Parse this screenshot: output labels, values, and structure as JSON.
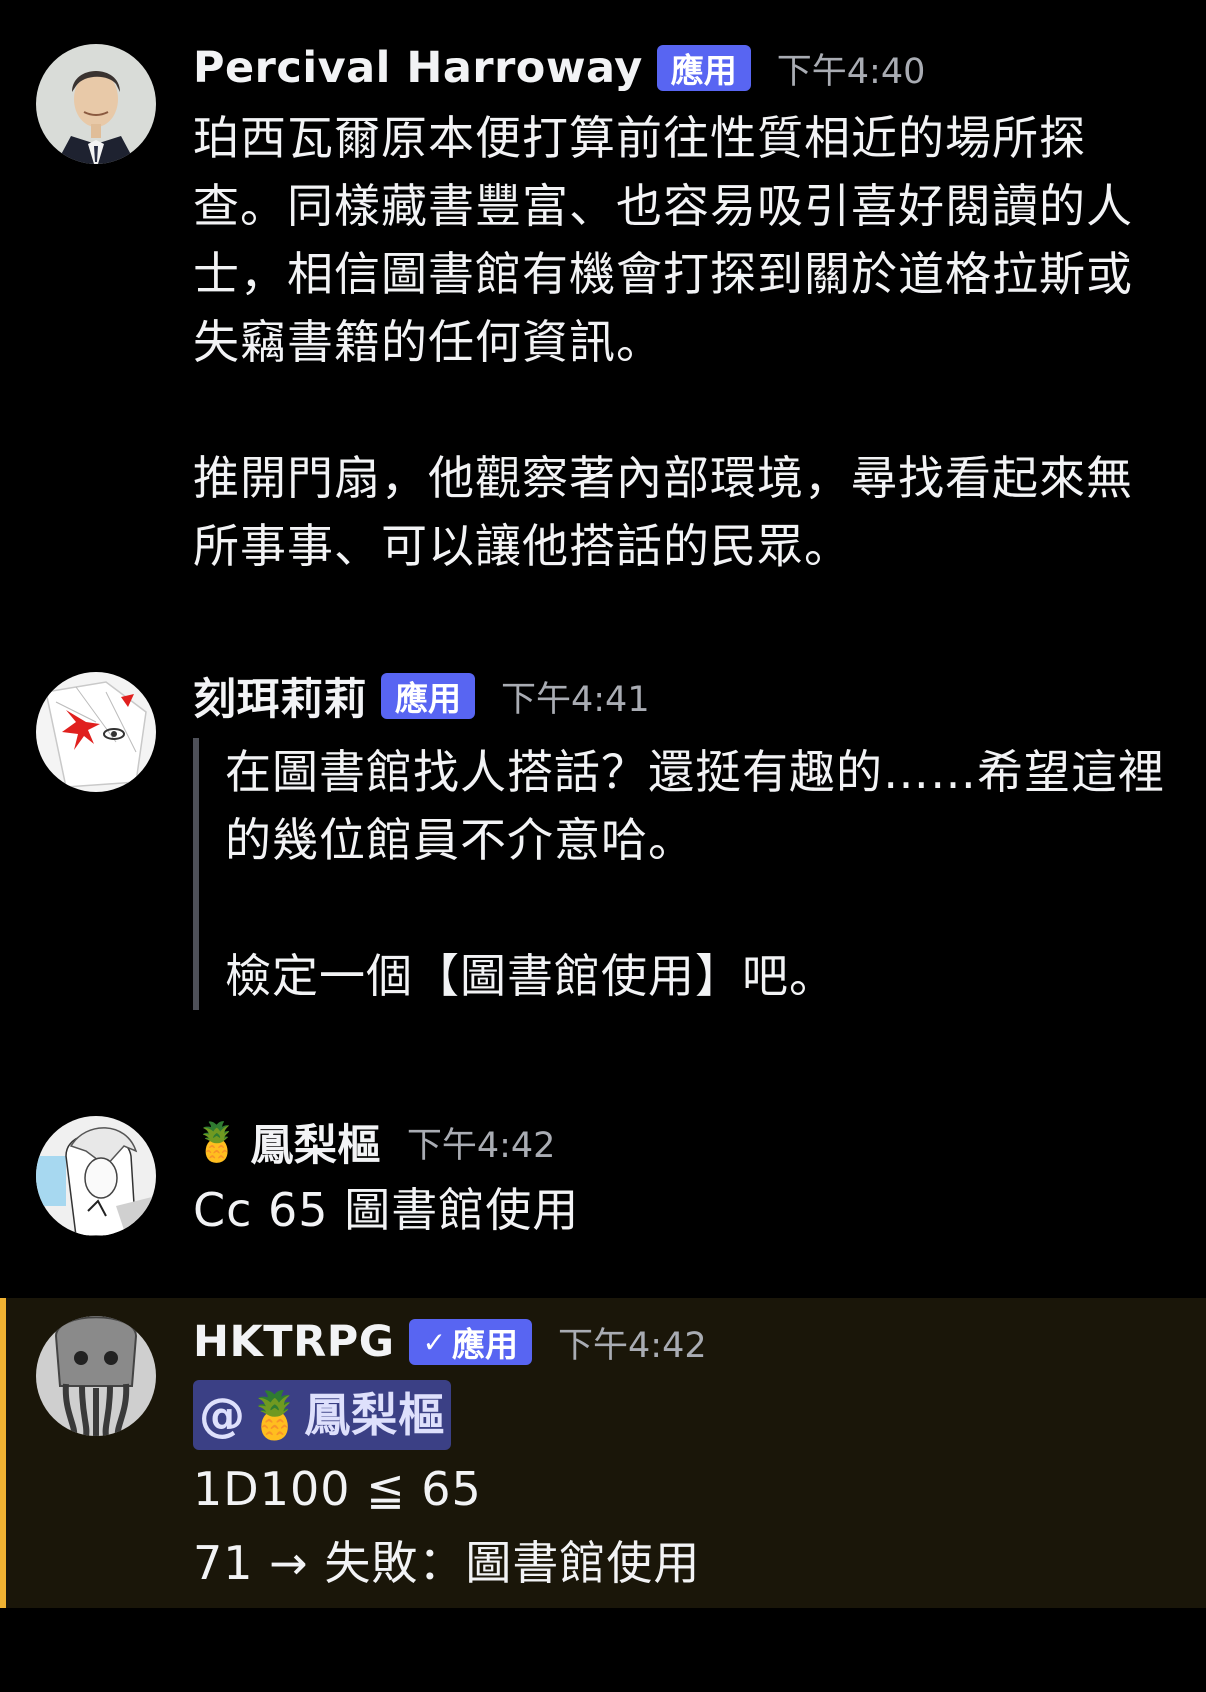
{
  "messages": [
    {
      "username": "Percival Harroway",
      "badge": "應用",
      "timestamp": "下午4:40",
      "paragraphs": [
        "珀西瓦爾原本便打算前往性質相近的場所探查。同樣藏書豐富、也容易吸引喜好閱讀的人士，相信圖書館有機會打探到關於道格拉斯或失竊書籍的任何資訊。",
        "推開門扇，他觀察著內部環境，尋找看起來無所事事、可以讓他搭話的民眾。"
      ]
    },
    {
      "username": "刻珥莉莉",
      "badge": "應用",
      "timestamp": "下午4:41",
      "quote_paragraphs": [
        "在圖書館找人搭話？還挺有趣的……希望這裡的幾位館員不介意哈。",
        "檢定一個【圖書館使用】吧。"
      ]
    },
    {
      "username_emoji": "🍍",
      "username": "鳳梨樞",
      "timestamp": "下午4:42",
      "text": "Cc 65 圖書館使用"
    },
    {
      "username": "HKTRPG",
      "badge": "應用",
      "badge_check": "✓",
      "timestamp": "下午4:42",
      "mention_at": "@",
      "mention_emoji": "🍍",
      "mention_name": "鳳梨樞",
      "roll_line": "1D100 ≦ 65",
      "result_line": "71 → 失敗：圖書館使用"
    }
  ],
  "colors": {
    "background": "#000000",
    "badge": "#5865f2",
    "timestamp": "#a9acb3",
    "quote_bar": "#4e5058",
    "highlight_bg": "#1a1609",
    "highlight_bar": "#f0b232",
    "mention_bg": "#3b4085"
  }
}
